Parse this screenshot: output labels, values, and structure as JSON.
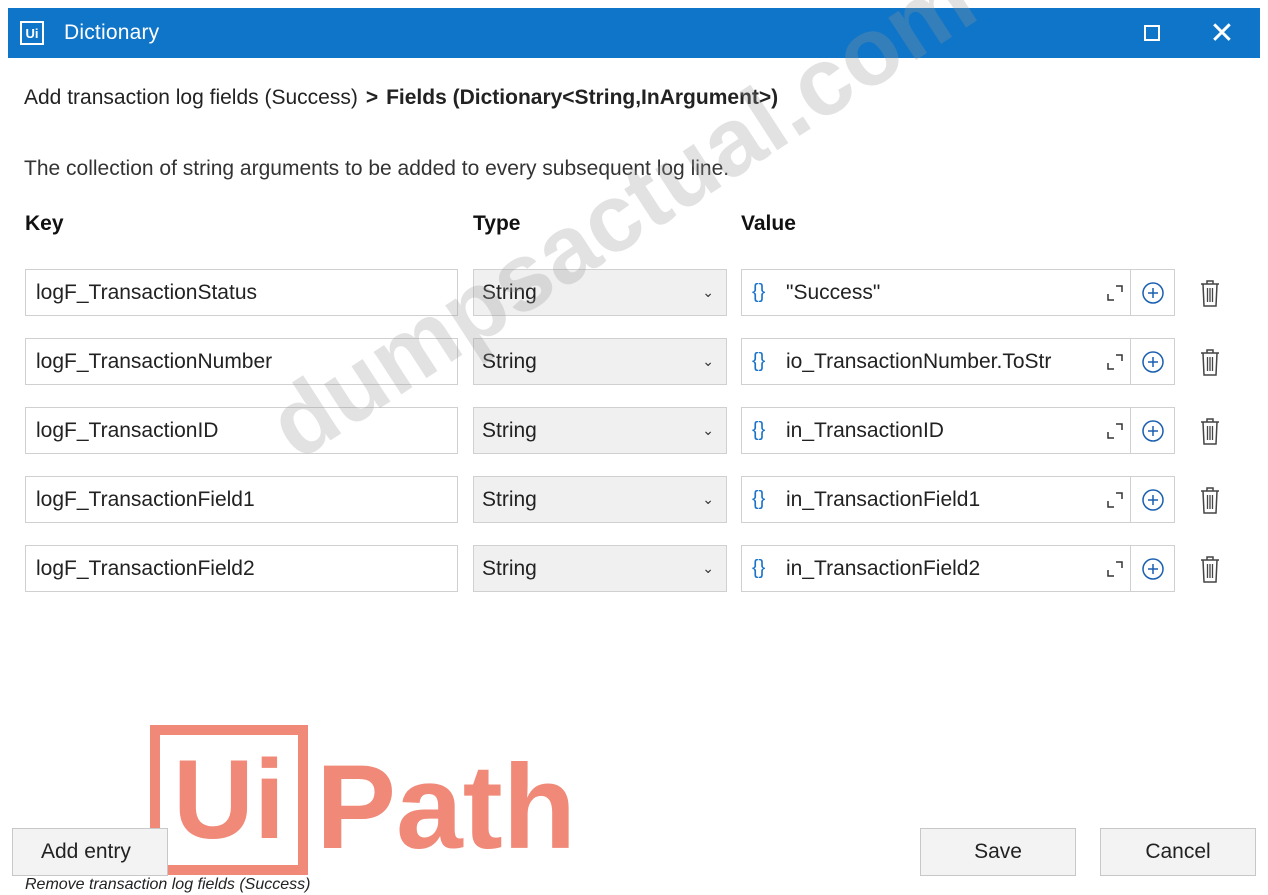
{
  "window": {
    "app_icon_text": "Ui",
    "title": "Dictionary",
    "maximize_icon": "maximize-icon",
    "close_glyph": "✕"
  },
  "breadcrumb": {
    "parent": "Add transaction log fields (Success)",
    "separator": ">",
    "current": "Fields (Dictionary<String,InArgument>)"
  },
  "description": "The collection of string arguments to be added to every subsequent log line.",
  "columns": {
    "key": "Key",
    "type": "Type",
    "value": "Value"
  },
  "rows": [
    {
      "key": "logF_TransactionStatus",
      "type": "String",
      "value": "\"Success\""
    },
    {
      "key": "logF_TransactionNumber",
      "type": "String",
      "value": "io_TransactionNumber.ToStr"
    },
    {
      "key": "logF_TransactionID",
      "type": "String",
      "value": "in_TransactionID"
    },
    {
      "key": "logF_TransactionField1",
      "type": "String",
      "value": "in_TransactionField1"
    },
    {
      "key": "logF_TransactionField2",
      "type": "String",
      "value": "in_TransactionField2"
    }
  ],
  "expression_glyph": "{}",
  "dropdown_glyph": "▼",
  "watermark": "dumpsactual.com",
  "overlay_logo": {
    "box": "Ui",
    "text": "Path",
    "color": "#f08978"
  },
  "buttons": {
    "add_entry": "Add entry",
    "save": "Save",
    "cancel": "Cancel"
  },
  "footer_caption": "Remove transaction log fields (Success)",
  "colors": {
    "titlebar": "#0f75c8",
    "brace": "#1a73c9"
  }
}
